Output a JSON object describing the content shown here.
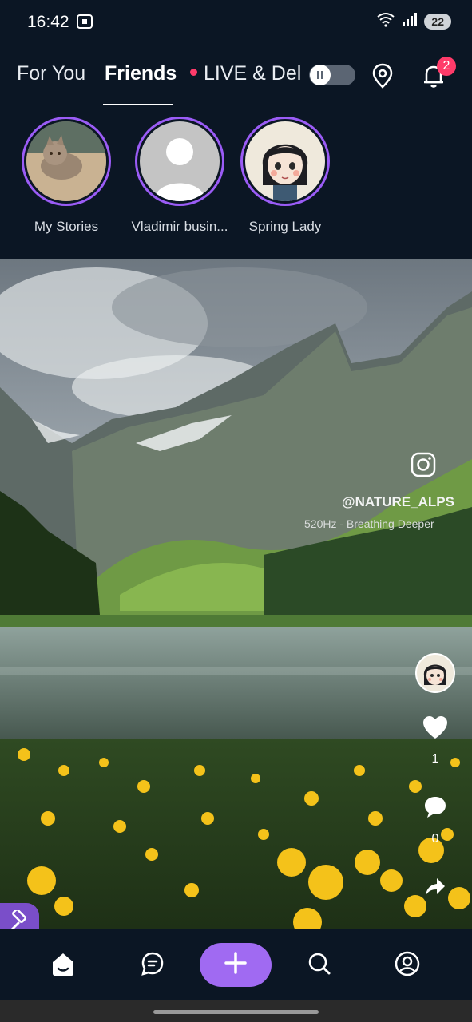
{
  "status_bar": {
    "time": "16:42",
    "battery": "22",
    "wifi_label": "6"
  },
  "top_nav": {
    "tabs": [
      {
        "label": "For You"
      },
      {
        "label": "Friends"
      },
      {
        "label": "LIVE & Del"
      }
    ],
    "active_tab": "Friends",
    "notification_count": "2"
  },
  "stories": [
    {
      "label": "My Stories"
    },
    {
      "label": "Vladimir busin..."
    },
    {
      "label": "Spring Lady"
    }
  ],
  "video": {
    "handle": "@NATURE_ALPS",
    "song": "520Hz - Breathing Deeper",
    "likes": "1",
    "comments": "0"
  },
  "colors": {
    "accent": "#9b5cf6",
    "create": "#a06af2",
    "live_dot": "#ff3b6a",
    "background": "#0b1624"
  },
  "icons": [
    "screen-record-icon",
    "wifi-icon",
    "signal-icon",
    "pause-icon",
    "location-pin-icon",
    "bell-icon",
    "instagram-icon",
    "heart-icon",
    "comment-icon",
    "share-icon",
    "hammer-icon",
    "home-icon",
    "messages-icon",
    "plus-icon",
    "search-icon",
    "profile-icon"
  ]
}
